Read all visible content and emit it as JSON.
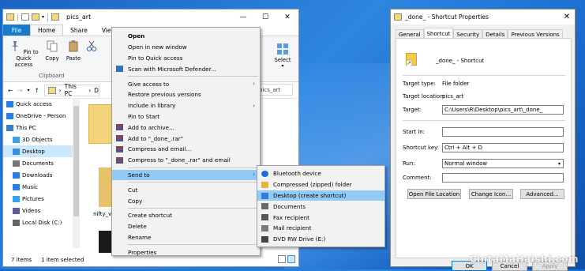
{
  "explorer": {
    "title": "pics_art",
    "ribbon_tabs": [
      "File",
      "Home",
      "Share",
      "View"
    ],
    "ribbon_buttons": {
      "pin": "Pin to Quick access",
      "copy": "Copy",
      "paste": "Paste",
      "select": "Select",
      "clipboard_group": "Clipboard"
    },
    "address": {
      "this_pc": "This PC",
      "d_crumb": "D",
      "right_crumb": "pics_art"
    },
    "nav": [
      {
        "label": "Quick access",
        "selected": false
      },
      {
        "label": "OneDrive - Person",
        "selected": false
      },
      {
        "label": "This PC",
        "selected": false
      },
      {
        "label": "3D Objects",
        "selected": false
      },
      {
        "label": "Desktop",
        "selected": true
      },
      {
        "label": "Documents",
        "selected": false
      },
      {
        "label": "Downloads",
        "selected": false
      },
      {
        "label": "Music",
        "selected": false
      },
      {
        "label": "Pictures",
        "selected": false
      },
      {
        "label": "Videos",
        "selected": false
      },
      {
        "label": "Local Disk (C:)",
        "selected": false
      }
    ],
    "file_label": "nifty_v",
    "status": {
      "items": "7 items",
      "selected": "1 item selected"
    }
  },
  "context_menu": {
    "items": [
      {
        "label": "Open",
        "bold": true
      },
      {
        "label": "Open in new window"
      },
      {
        "label": "Pin to Quick access"
      },
      {
        "label": "Scan with Microsoft Defender..."
      },
      {
        "sep": true
      },
      {
        "label": "Give access to",
        "arrow": true
      },
      {
        "label": "Restore previous versions"
      },
      {
        "label": "Include in library",
        "arrow": true
      },
      {
        "label": "Pin to Start"
      },
      {
        "label": "Add to archive...",
        "icon": "rar"
      },
      {
        "label": "Add to \"_done_.rar\"",
        "icon": "rar"
      },
      {
        "label": "Compress and email...",
        "icon": "rar"
      },
      {
        "label": "Compress to \"_done_.rar\" and email",
        "icon": "rar"
      },
      {
        "sep": true
      },
      {
        "label": "Send to",
        "arrow": true,
        "highlight": true
      },
      {
        "sep": true
      },
      {
        "label": "Cut"
      },
      {
        "label": "Copy"
      },
      {
        "sep": true
      },
      {
        "label": "Create shortcut"
      },
      {
        "label": "Delete"
      },
      {
        "label": "Rename"
      },
      {
        "sep": true
      },
      {
        "label": "Properties"
      }
    ]
  },
  "send_to": {
    "items": [
      {
        "label": "Bluetooth device",
        "icon": "bluetooth",
        "color": "#1a6fd8"
      },
      {
        "label": "Compressed (zipped) folder",
        "icon": "zip",
        "color": "#e9b634"
      },
      {
        "label": "Desktop (create shortcut)",
        "icon": "desktop",
        "color": "#2f7ed8",
        "highlight": true
      },
      {
        "label": "Documents",
        "icon": "documents",
        "color": "#6a6a6a"
      },
      {
        "label": "Fax recipient",
        "icon": "fax",
        "color": "#555555"
      },
      {
        "label": "Mail recipient",
        "icon": "mail",
        "color": "#7a7a7a"
      },
      {
        "label": "DVD RW Drive (E:)",
        "icon": "dvd",
        "color": "#444444"
      }
    ]
  },
  "properties": {
    "title": "_done_ - Shortcut Properties",
    "tabs": [
      "General",
      "Shortcut",
      "Security",
      "Details",
      "Previous Versions"
    ],
    "active_tab": "Shortcut",
    "name": "_done_ - Shortcut",
    "target_type_label": "Target type:",
    "target_type": "File folder",
    "target_location_label": "Target location:",
    "target_location": "pics_art",
    "target_label": "Target:",
    "target": "C:\\Users\\R\\Desktop\\pics_art\\_done_",
    "start_in_label": "Start in:",
    "start_in": "",
    "shortcut_key_label": "Shortcut key:",
    "shortcut_key": "Ctrl + Alt + D",
    "run_label": "Run:",
    "run": "Normal window",
    "comment_label": "Comment:",
    "comment": "",
    "buttons": {
      "open_location": "Open File Location",
      "change_icon": "Change Icon...",
      "advanced": "Advanced..."
    },
    "bottom_buttons": {
      "ok": "OK",
      "cancel": "Cancel",
      "apply": "Apply"
    }
  },
  "watermark": "CintaMaHaishi.com",
  "colors": {
    "file_tab": "#1979ca",
    "menu_highlight": "#91c9f7",
    "selection": "#cce8ff"
  }
}
